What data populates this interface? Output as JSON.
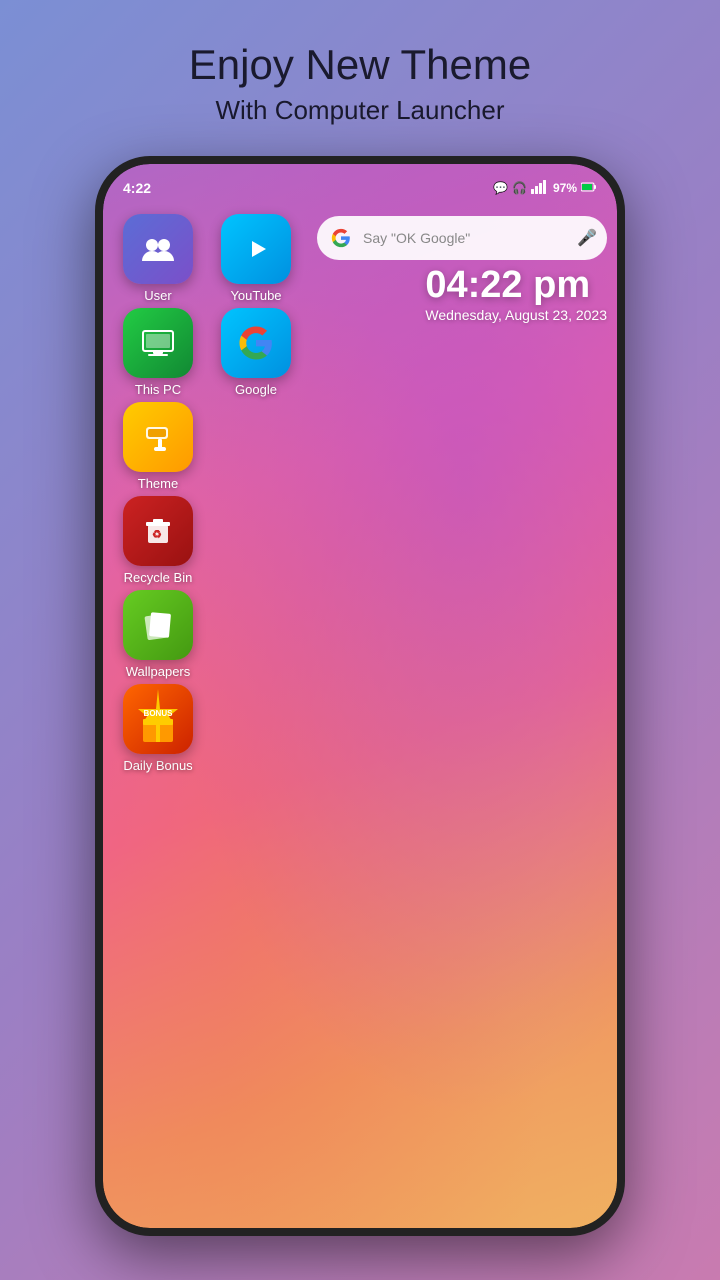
{
  "header": {
    "title": "Enjoy New Theme",
    "subtitle": "With Computer Launcher"
  },
  "status_bar": {
    "time": "4:22",
    "battery": "97%",
    "signal_bars": "▂▄▆█"
  },
  "search_bar": {
    "placeholder": "Say \"OK Google\"",
    "g_letter": "G"
  },
  "clock": {
    "time": "04:22 pm",
    "date": "Wednesday, August 23, 2023"
  },
  "apps": [
    {
      "id": "user",
      "label": "User",
      "row": 0,
      "col": 0
    },
    {
      "id": "youtube",
      "label": "YouTube",
      "row": 0,
      "col": 1
    },
    {
      "id": "thispc",
      "label": "This PC",
      "row": 1,
      "col": 0
    },
    {
      "id": "google",
      "label": "Google",
      "row": 1,
      "col": 1
    },
    {
      "id": "theme",
      "label": "Theme",
      "row": 2,
      "col": 0
    },
    {
      "id": "recycle",
      "label": "Recycle Bin",
      "row": 3,
      "col": 0
    },
    {
      "id": "wallpapers",
      "label": "Wallpapers",
      "row": 4,
      "col": 0
    },
    {
      "id": "dailybonus",
      "label": "Daily Bonus",
      "row": 5,
      "col": 0
    }
  ]
}
